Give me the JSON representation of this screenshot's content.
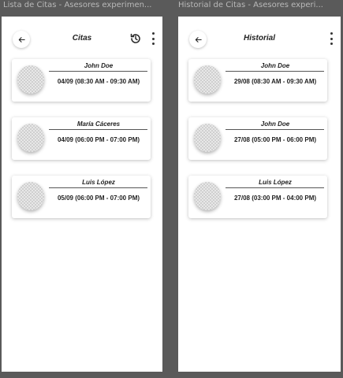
{
  "frames": {
    "left": {
      "window_title": "Lista de Citas - Asesores experimen...",
      "title": "Citas",
      "cards": [
        {
          "name": "John Doe",
          "time": "04/09 (08:30 AM - 09:30 AM)"
        },
        {
          "name": "María Cáceres",
          "time": "04/09 (06:00 PM - 07:00 PM)"
        },
        {
          "name": "Luis López",
          "time": "05/09 (06:00 PM - 07:00 PM)"
        }
      ]
    },
    "right": {
      "window_title": "Historial de Citas - Asesores experi...",
      "title": "Historial",
      "cards": [
        {
          "name": "John Doe",
          "time": "29/08 (08:30 AM - 09:30 AM)"
        },
        {
          "name": "John Doe",
          "time": "27/08 (05:00 PM - 06:00 PM)"
        },
        {
          "name": "Luis López",
          "time": "27/08 (03:00 PM - 04:00 PM)"
        }
      ]
    }
  },
  "icons": {
    "back": "arrow-left-icon",
    "history": "history-icon",
    "more": "more-vertical-icon",
    "avatar": "avatar-placeholder"
  },
  "colors": {
    "canvas": "#5a5a5a",
    "screen": "#ffffff",
    "text": "#222222"
  }
}
